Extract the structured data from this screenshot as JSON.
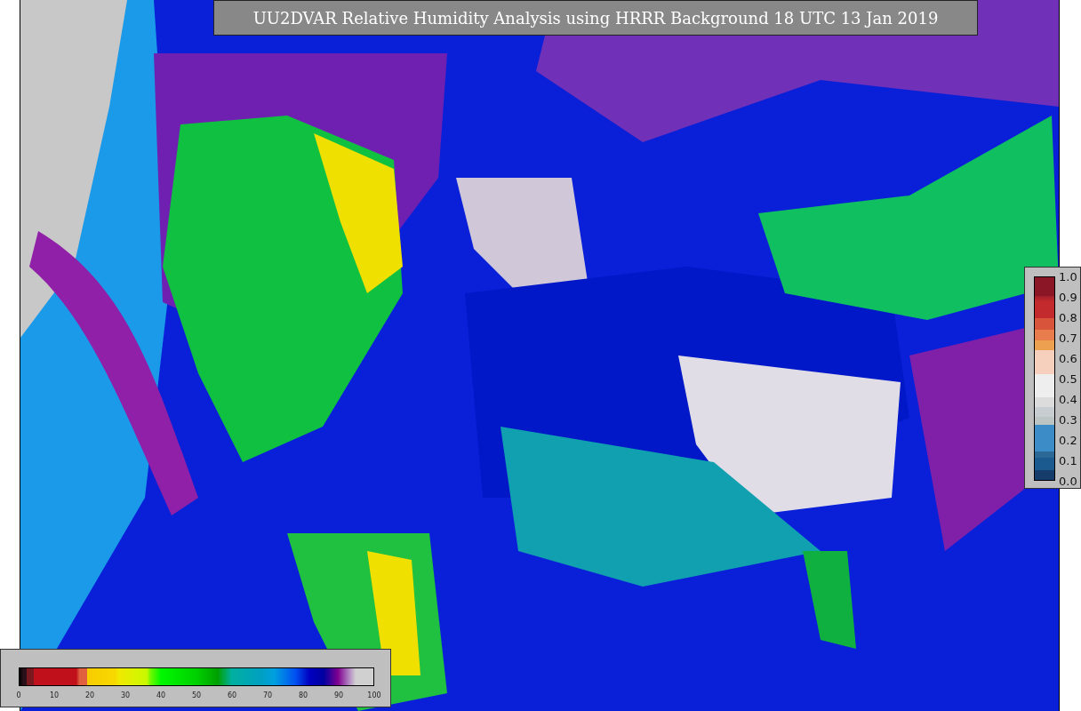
{
  "title": "UU2DVAR Relative Humidity Analysis using HRRR Background 18 UTC 13 Jan 2019",
  "colorbar_right": {
    "ticks": [
      "1.0",
      "0.9",
      "0.8",
      "0.7",
      "0.6",
      "0.5",
      "0.4",
      "0.3",
      "0.2",
      "0.1",
      "0.0"
    ]
  },
  "colorbar_bottom": {
    "ticks": [
      "0",
      "10",
      "20",
      "30",
      "40",
      "50",
      "60",
      "70",
      "80",
      "90",
      "100"
    ]
  }
}
